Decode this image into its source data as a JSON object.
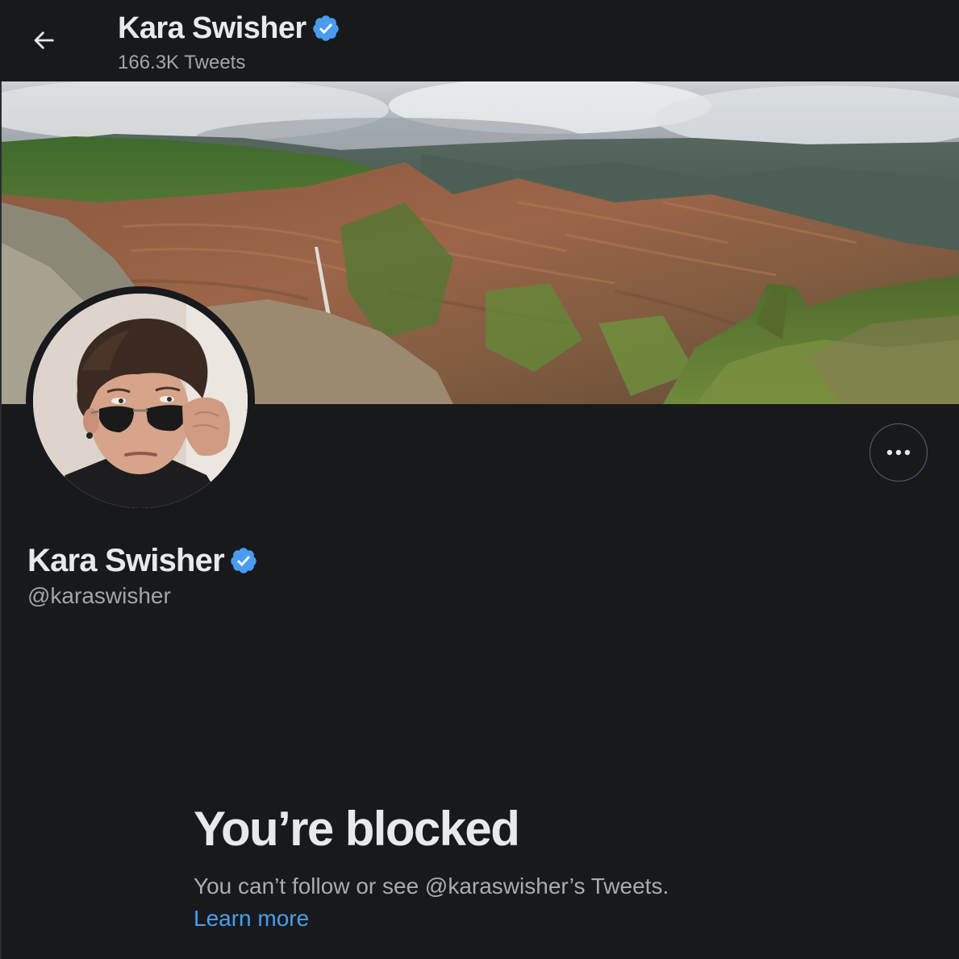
{
  "header": {
    "title": "Kara Swisher",
    "tweet_count": "166.3K Tweets"
  },
  "icons": {
    "back": "arrow-left-icon",
    "verified": "verified-badge-icon",
    "more": "ellipsis-icon"
  },
  "profile": {
    "name": "Kara Swisher",
    "handle": "@karaswisher"
  },
  "blocked": {
    "title": "You’re blocked",
    "description": "You can’t follow or see @karaswisher’s Tweets.",
    "link_label": "Learn more"
  },
  "colors": {
    "background": "#18191c",
    "primary_text": "#e7e9ea",
    "secondary_text": "#a3a5a8",
    "link": "#479ef0",
    "verified": "#4a9cf0"
  }
}
